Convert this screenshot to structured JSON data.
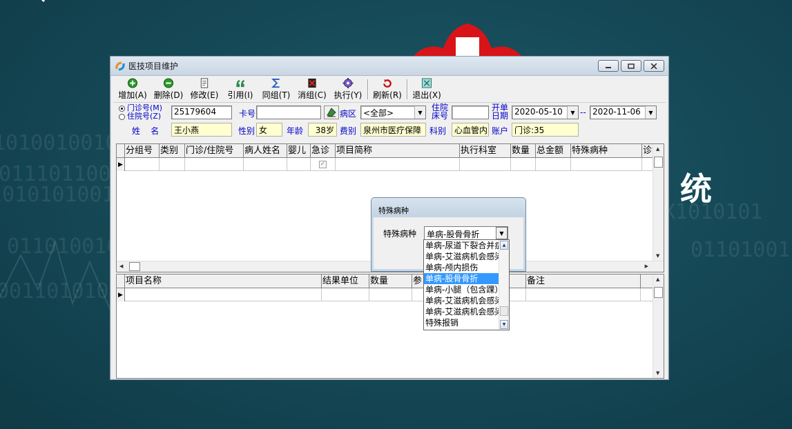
{
  "background": {
    "side_text": "统"
  },
  "window": {
    "title": "医技项目维护",
    "controls": [
      "minimize",
      "maximize",
      "close"
    ]
  },
  "toolbar": {
    "buttons": [
      {
        "label": "增加(A)",
        "icon": "add-icon",
        "color": "#2a9a2a"
      },
      {
        "label": "删除(D)",
        "icon": "delete-icon",
        "color": "#2a9a2a"
      },
      {
        "label": "修改(E)",
        "icon": "edit-icon",
        "color": "#555"
      },
      {
        "label": "引用(I)",
        "icon": "reference-icon",
        "color": "#2a8a4a"
      },
      {
        "label": "同组(T)",
        "icon": "sigma-icon",
        "color": "#1f5fbf"
      },
      {
        "label": "消组(C)",
        "icon": "ungroup-icon",
        "color": "#c01010"
      },
      {
        "label": "执行(Y)",
        "icon": "execute-icon",
        "color": "#5a3aa0"
      },
      {
        "label": "刷新(R)",
        "icon": "refresh-icon",
        "color": "#c01010"
      },
      {
        "label": "退出(X)",
        "icon": "exit-icon",
        "color": "#2a8a8a"
      }
    ]
  },
  "form": {
    "radio_outpatient": "门诊号(M)",
    "radio_inpatient": "住院号(Z)",
    "id_value": "25179604",
    "card_label": "卡号",
    "card_value": "",
    "ward_label": "病区",
    "ward_value": "<全部>",
    "bed_label_1": "住院",
    "bed_label_2": "床号",
    "bed_value": "",
    "date_label_1": "开单",
    "date_label_2": "日期",
    "date_from": "2020-05-10",
    "date_sep": "--",
    "date_to": "2020-11-06",
    "name_label": "姓    名",
    "name_value": "王小燕",
    "gender_label": "性别",
    "gender_value": "女",
    "age_label": "年龄",
    "age_value": "38岁",
    "fee_label": "费别",
    "fee_value": "泉州市医疗保障",
    "dept_label": "科别",
    "dept_value": "心血管内",
    "account_label": "账户",
    "account_value": "门诊:35"
  },
  "grid_top": {
    "columns": [
      "分组号",
      "类别",
      "门诊/住院号",
      "病人姓名",
      "婴儿",
      "急诊",
      "项目简称",
      "执行科室",
      "数量",
      "总金额",
      "特殊病种",
      "诊"
    ]
  },
  "grid_bottom": {
    "columns": [
      "项目名称",
      "结果单位",
      "数量",
      "参",
      "",
      "备注"
    ]
  },
  "dialog": {
    "title": "特殊病种",
    "label": "特殊病种",
    "selected": "单病-股骨骨折",
    "options": [
      "单病-尿道下裂合并症",
      "单病-艾滋病机会感染",
      "单病-颅内损伤",
      "单病-股骨骨折",
      "单病-小腿（包含踝）",
      "单病-艾滋病机会感染",
      "单病-艾滋病机会感染",
      "特殊报销"
    ],
    "selected_index": 3
  }
}
